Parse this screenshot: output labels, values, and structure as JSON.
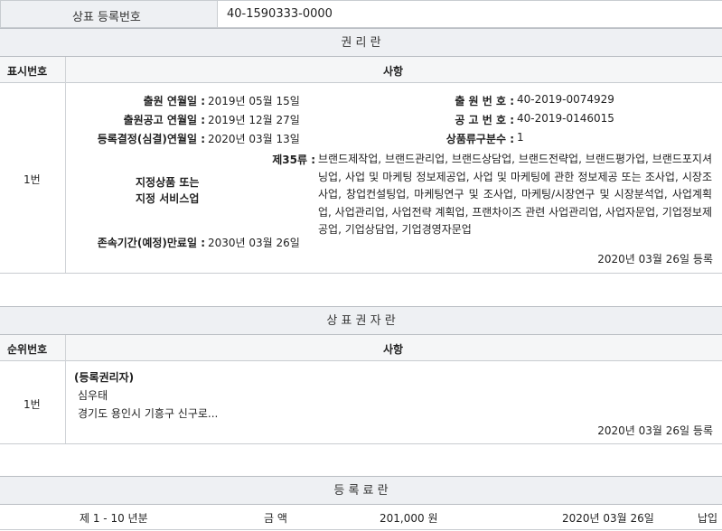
{
  "reg": {
    "label": "상표 등록번호",
    "value": "40-1590333-0000"
  },
  "rights": {
    "title": "권 리 란",
    "col_no": "표시번호",
    "col_item": "사항",
    "row_no": "1번",
    "app_date_label": "출원 연월일 :",
    "app_date": "2019년 05월 15일",
    "app_no_label": "출 원 번 호 :",
    "app_no": "40-2019-0074929",
    "pub_date_label": "출원공고 연월일 :",
    "pub_date": "2019년 12월 27일",
    "pub_no_label": "공 고 번 호 :",
    "pub_no": "40-2019-0146015",
    "decision_label": "등록결정(심결)연월일 :",
    "decision_date": "2020년 03월 13일",
    "class_count_label": "상품류구분수 :",
    "class_count": "1",
    "goods_label_line1": "지정상품 또는",
    "goods_label_line2": "지정 서비스업",
    "class_label": "제35류 :",
    "goods_desc": "브랜드제작업, 브랜드관리업, 브랜드상담업, 브랜드전략업, 브랜드평가업, 브랜드포지셔닝업, 사업 및 마케팅 정보제공업, 사업 및 마케팅에 관한 정보제공 또는 조사업, 시장조사업, 창업컨설팅업, 마케팅연구 및 조사업, 마케팅/시장연구 및 시장분석업, 사업계획업, 사업관리업, 사업전략 계획업, 프랜차이즈 관련 사업관리업, 사업자문업, 기업정보제공업, 기업상담업, 기업경영자문업",
    "expiry_label": "존속기간(예정)만료일 :",
    "expiry_date": "2030년 03월 26일",
    "reg_note": "2020년 03월 26일 등록"
  },
  "holder": {
    "title": "상 표 권 자 란",
    "col_no": "순위번호",
    "col_item": "사항",
    "row_no": "1번",
    "type": "(등록권리자)",
    "name": "심우태",
    "address": "경기도 용인시 기흥구 신구로...",
    "reg_note": "2020년 03월 26일 등록"
  },
  "fees": {
    "title": "등 록 료 란",
    "period": "제 1 - 10 년분",
    "amount_label": "금 액",
    "amount": "201,000 원",
    "date": "2020년 03월 26일",
    "status": "납입"
  }
}
